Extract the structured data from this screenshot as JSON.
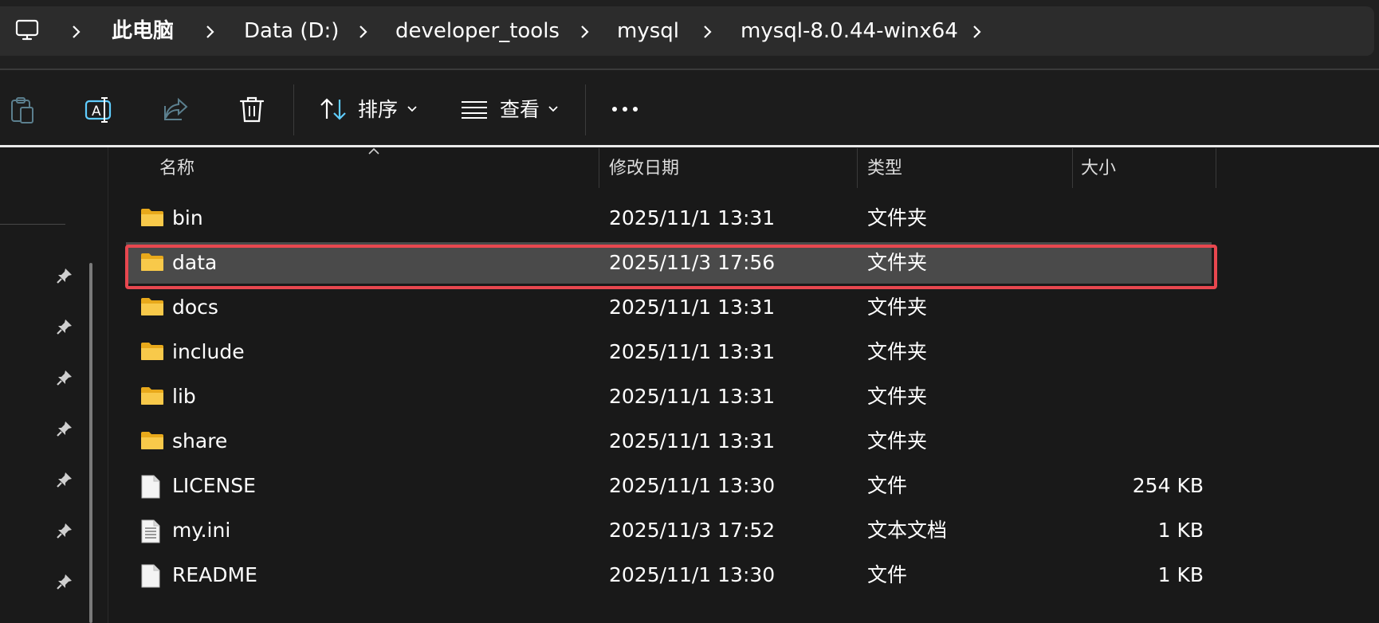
{
  "address_bar": {
    "crumbs": [
      "此电脑",
      "Data (D:)",
      "developer_tools",
      "mysql",
      "mysql-8.0.44-winx64"
    ]
  },
  "toolbar": {
    "sort_label": "排序",
    "view_label": "查看"
  },
  "columns": {
    "name": "名称",
    "date": "修改日期",
    "type": "类型",
    "size": "大小"
  },
  "files": [
    {
      "name": "bin",
      "date": "2025/11/1 13:31",
      "type": "文件夹",
      "size": "",
      "icon": "folder-icon"
    },
    {
      "name": "data",
      "date": "2025/11/3 17:56",
      "type": "文件夹",
      "size": "",
      "icon": "folder-icon",
      "selected": true
    },
    {
      "name": "docs",
      "date": "2025/11/1 13:31",
      "type": "文件夹",
      "size": "",
      "icon": "folder-icon"
    },
    {
      "name": "include",
      "date": "2025/11/1 13:31",
      "type": "文件夹",
      "size": "",
      "icon": "folder-icon"
    },
    {
      "name": "lib",
      "date": "2025/11/1 13:31",
      "type": "文件夹",
      "size": "",
      "icon": "folder-icon"
    },
    {
      "name": "share",
      "date": "2025/11/1 13:31",
      "type": "文件夹",
      "size": "",
      "icon": "folder-icon"
    },
    {
      "name": "LICENSE",
      "date": "2025/11/1 13:30",
      "type": "文件",
      "size": "254 KB",
      "icon": "file-icon"
    },
    {
      "name": "my.ini",
      "date": "2025/11/3 17:52",
      "type": "文本文档",
      "size": "1 KB",
      "icon": "text-file-icon"
    },
    {
      "name": "README",
      "date": "2025/11/1 13:30",
      "type": "文件",
      "size": "1 KB",
      "icon": "file-icon"
    }
  ],
  "colors": {
    "background": "#191919",
    "selection": "#4a4a4a",
    "highlight_border": "#e8474f",
    "folder_yellow": "#f5c242",
    "accent_blue": "#60cdff"
  }
}
